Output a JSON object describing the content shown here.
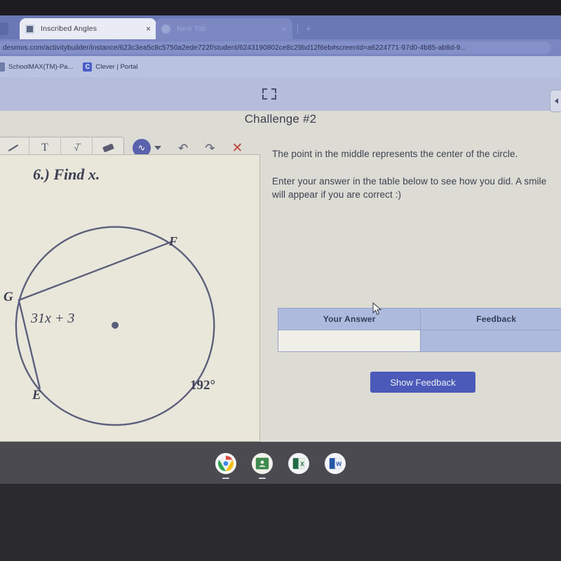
{
  "browser": {
    "tabs": [
      {
        "title": "Inscribed Angles",
        "close": "×",
        "favicon": "desmos-favicon"
      },
      {
        "title": "New Tab",
        "close": "×",
        "favicon": "newtab-favicon"
      }
    ],
    "new_tab_button": "+",
    "url": "desmos.com/activitybuilder/instance/623c3ea5c8c5750a2ede722f/student/6243190802ce8c29bd12f6eb#screenId=a6224771-97d0-4b85-ab8d-9...",
    "bookmarks": [
      {
        "label": "SchoolMAX(TM)-Pa...",
        "icon": "page-icon"
      },
      {
        "label": "Clever | Portal",
        "icon": "clever-icon",
        "glyph": "C"
      }
    ]
  },
  "activity": {
    "title": "Challenge #2",
    "fullscreen_icon": "fullscreen-icon",
    "panel_arrow": "▶"
  },
  "sketch": {
    "tools": [
      {
        "name": "pen-tool",
        "label": ""
      },
      {
        "name": "text-tool",
        "label": "T"
      },
      {
        "name": "math-tool",
        "label": "√̅"
      },
      {
        "name": "eraser-tool",
        "label": ""
      }
    ],
    "color_button": {
      "name": "color-picker-button",
      "glyph": "∿"
    },
    "undo": "↶",
    "redo": "↷",
    "close": "✕"
  },
  "figure": {
    "prompt": "6.) Find x.",
    "labels": {
      "F": "F",
      "G": "G",
      "E": "E",
      "angle_expression": "31x + 3",
      "arc_measure": "192°"
    }
  },
  "instructions": {
    "paragraph1": "The point in the middle represents the center of the circle.",
    "paragraph2": "Enter your answer in the table below to see how you did. A smile will appear if you are correct :)"
  },
  "table": {
    "headers": [
      "Your Answer",
      "Feedback"
    ],
    "rows": [
      {
        "answer": "",
        "feedback": ""
      }
    ]
  },
  "buttons": {
    "show_feedback": "Show Feedback"
  },
  "shelf": {
    "icons": [
      {
        "name": "chrome-icon",
        "label": "Chrome"
      },
      {
        "name": "google-classroom-icon",
        "label": "Classroom"
      },
      {
        "name": "excel-icon",
        "label": "Excel"
      },
      {
        "name": "word-icon",
        "label": "Word"
      }
    ]
  },
  "colors": {
    "browser_chrome": "#6a78b6",
    "bookmarks_bar": "#b9c2e0",
    "activity_top": "#b6bddb",
    "page_bg": "#dcdcd4",
    "sketch_bg": "#e8e7da",
    "table_header": "#adbade",
    "button_blue": "#4b5ab8",
    "shelf": "#4a4a50",
    "ink": "#5a5c74"
  }
}
